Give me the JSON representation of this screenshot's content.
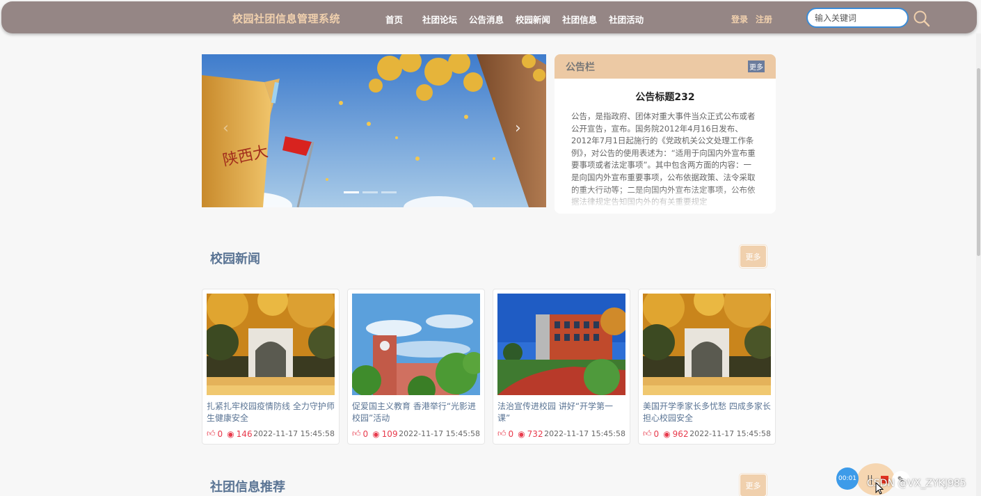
{
  "header": {
    "brand": "校园社团信息管理系统",
    "nav": [
      "首页",
      "社团论坛",
      "公告消息",
      "校园新闻",
      "社团信息",
      "社团活动"
    ],
    "login": "登录",
    "register": "注册",
    "search_placeholder": "输入关键词"
  },
  "notice": {
    "header": "公告栏",
    "more": "更多",
    "title": "公告标题232",
    "body": "公告，是指政府、团体对重大事件当众正式公布或者公开宣告，宣布。国务院2012年4月16日发布、2012年7月1日起施行的《党政机关公文处理工作条例》，对公告的使用表述为：“适用于向国内外宣布重要事项或者法定事项”。其中包含两方面的内容：一是向国内外宣布重要事项，公布依据政策、法令采取的重大行动等；二是向国内外宣布法定事项，公布依据法律规定告知国内外的有关重要规定"
  },
  "news": {
    "title": "校园新闻",
    "more": "更多",
    "items": [
      {
        "title": "扎紧扎牢校园疫情防线 全力守护师生健康安全",
        "likes": "0",
        "views": "146",
        "date": "2022-11-17 15:45:58",
        "image": "ginkgo-gate"
      },
      {
        "title": "促爱国主义教育 香港举行“光影进校园”活动",
        "likes": "0",
        "views": "109",
        "date": "2022-11-17 15:45:58",
        "image": "clock-tower"
      },
      {
        "title": "法治宣传进校园 讲好“开学第一课”",
        "likes": "0",
        "views": "732",
        "date": "2022-11-17 15:45:58",
        "image": "campus-building"
      },
      {
        "title": "美国开学季家长多忧愁 四成多家长担心校园安全",
        "likes": "0",
        "views": "962",
        "date": "2022-11-17 15:45:58",
        "image": "ginkgo-gate"
      }
    ]
  },
  "clubs": {
    "title": "社团信息推荐",
    "more": "更多"
  },
  "recorder": {
    "timer": "00:01",
    "pause": "||"
  },
  "watermark": "CSDN @VX_ZYKJ985",
  "colors": {
    "nav_bg": "#958685",
    "brand": "#f0d0ad",
    "section_title": "#5a7494",
    "stat_red": "#e83a4c"
  }
}
